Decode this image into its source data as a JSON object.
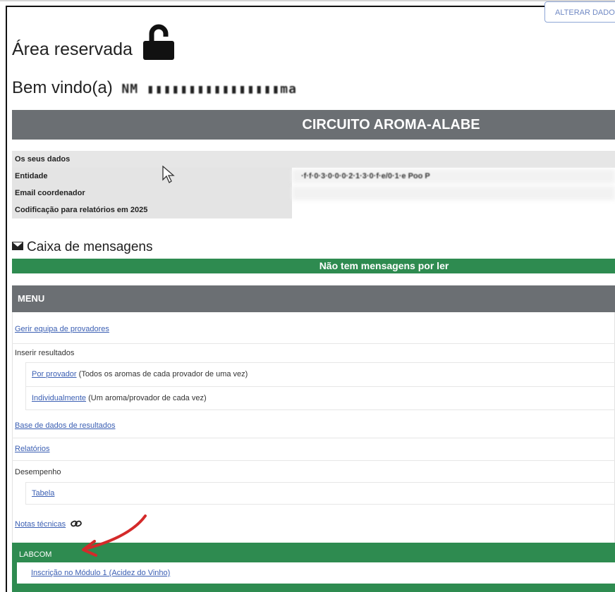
{
  "header": {
    "alter_button": "ALTERAR DADOS",
    "title": "Área reservada",
    "welcome_label": "Bem vindo(a)",
    "welcome_name": "NM ▮▮▮▮▮▮▮▮▮▮▮▮▮▮▮▮ma"
  },
  "circuit": {
    "title": "CIRCUITO AROMA-ALABE"
  },
  "data_section": {
    "heading": "Os seus dados",
    "rows": [
      {
        "label": "Entidade",
        "value": "·f·f·0·3·0·0·0·2·1·3·0·f·e/0·1·e Poo P"
      },
      {
        "label": "Email coordenador",
        "value": ""
      },
      {
        "label": "Codificação para relatórios em 2025",
        "value": ""
      }
    ]
  },
  "messages": {
    "title": "Caixa de mensagens",
    "status": "Não tem mensagens por ler"
  },
  "menu": {
    "title": "MENU",
    "gerir": "Gerir equipa de provadores",
    "inserir": "Inserir resultados",
    "por_provador_link": "Por provador",
    "por_provador_note": "(Todos os aromas de cada provador de uma vez)",
    "individual_link": "Individualmente",
    "individual_note": "(Um aroma/provador de cada vez)",
    "base_dados": "Base de dados de resultados",
    "relatorios": "Relatórios",
    "desempenho": "Desempenho",
    "tabela": "Tabela",
    "notas": "Notas técnicas"
  },
  "labcom": {
    "title": "LABCOM",
    "item": "Inscrição no Módulo 1 (Acidez do Vinho)"
  },
  "colors": {
    "green": "#2e8b50",
    "gray_bar": "#6b6f73",
    "link": "#3b5fb3",
    "annotation_arrow": "#d42a2a"
  }
}
